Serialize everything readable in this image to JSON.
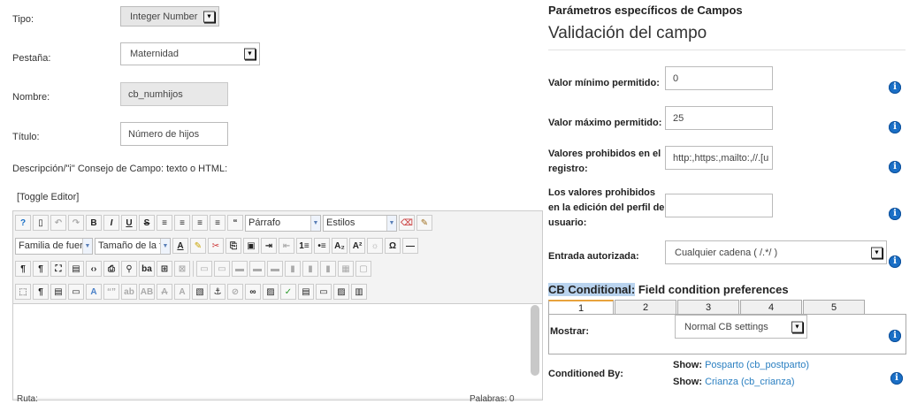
{
  "left_form": {
    "tipo_label": "Tipo:",
    "tipo_value": "Integer Number",
    "pestana_label": "Pestaña:",
    "pestana_value": "Maternidad",
    "nombre_label": "Nombre:",
    "nombre_value": "cb_numhijos",
    "titulo_label": "Título:",
    "titulo_value": "Número de hijos",
    "descripcion_label": "Descripción/\"i\" Consejo de Campo: texto o HTML:",
    "toggle_editor": "[Toggle Editor]"
  },
  "editor": {
    "format_select": "Párrafo",
    "styles_select": "Estilos",
    "font_family_select": "Familia de fuer",
    "font_size_select": "Tamaño de la f",
    "footer_left": "Ruta:",
    "footer_right": "Palabras: 0"
  },
  "right_panel": {
    "section_header": "Parámetros específicos de Campos",
    "section_title": "Validación del campo",
    "min_label": "Valor mínimo permitido:",
    "min_value": "0",
    "max_label": "Valor máximo permitido:",
    "max_value": "25",
    "forbidden_reg_label_1": "Valores prohibidos en el",
    "forbidden_reg_label_2": "registro:",
    "forbidden_reg_value": "http:,https:,mailto:,//.[u",
    "forbidden_edit_label_1": "Los valores prohibidos",
    "forbidden_edit_label_2": "en la edición del perfil de",
    "forbidden_edit_label_3": "usuario:",
    "forbidden_edit_value": "",
    "authorized_label": "Entrada autorizada:",
    "authorized_value": "Cualquier cadena ( /.*/ )",
    "info_glyph": "i"
  },
  "cb_conditional": {
    "title_highlight": "CB Conditional:",
    "title_rest": " Field condition preferences",
    "tabs": [
      "1",
      "2",
      "3",
      "4",
      "5"
    ],
    "mostrar_label": "Mostrar:",
    "mostrar_value": "Normal CB settings",
    "conditioned_label": "Conditioned By:",
    "show_label": "Show:",
    "show_1": "Posparto (cb_postparto)",
    "show_2": "Crianza (cb_crianza)"
  },
  "colors": {
    "info_blue": "#1a6fc6",
    "link_blue": "#2a7fc1",
    "tab_accent": "#e8a33d",
    "highlight": "#b9d3ee"
  }
}
